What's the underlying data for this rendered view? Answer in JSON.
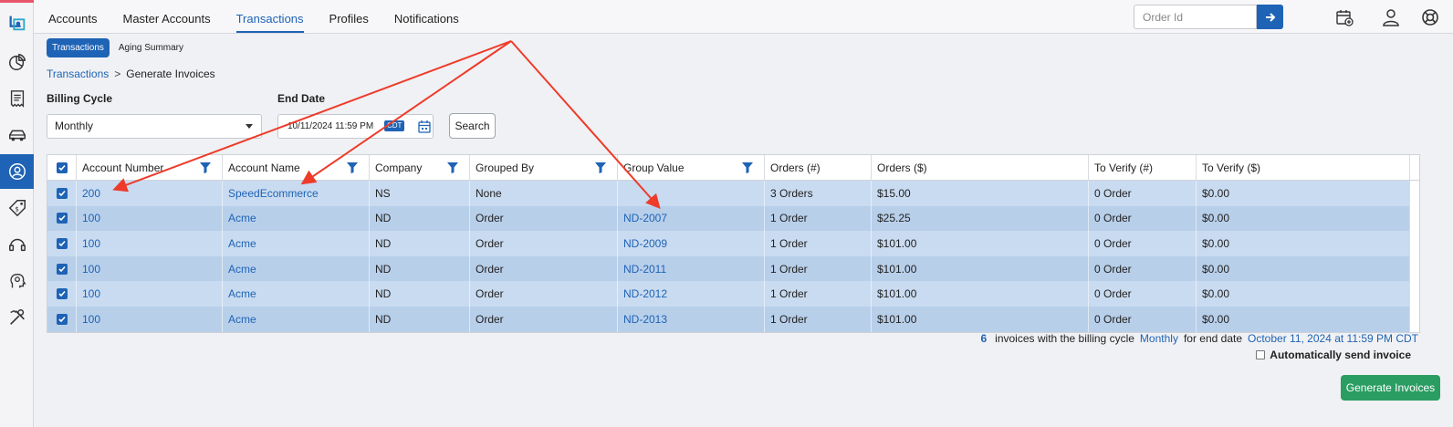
{
  "nav": {
    "tabs": [
      "Accounts",
      "Master Accounts",
      "Transactions",
      "Profiles",
      "Notifications"
    ],
    "active_tab": "Transactions",
    "order_placeholder": "Order Id"
  },
  "subtabs": [
    "Transactions",
    "Aging Summary"
  ],
  "breadcrumb": {
    "parent": "Transactions",
    "separator": ">",
    "current": "Generate Invoices"
  },
  "filters": {
    "billing_cycle_label": "Billing Cycle",
    "billing_cycle_value": "Monthly",
    "end_date_label": "End Date",
    "end_date_value": "10/11/2024 11:59 PM",
    "timezone": "CDT",
    "search_label": "Search"
  },
  "table": {
    "headers": [
      "Account Number",
      "Account Name",
      "Company",
      "Grouped By",
      "Group Value",
      "Orders (#)",
      "Orders ($)",
      "To Verify (#)",
      "To Verify ($)"
    ],
    "rows": [
      [
        "200",
        "SpeedEcommerce",
        "NS",
        "None",
        "",
        "3 Orders",
        "$15.00",
        "0 Order",
        "$0.00"
      ],
      [
        "100",
        "Acme",
        "ND",
        "Order",
        "ND-2007",
        "1 Order",
        "$25.25",
        "0 Order",
        "$0.00"
      ],
      [
        "100",
        "Acme",
        "ND",
        "Order",
        "ND-2009",
        "1 Order",
        "$101.00",
        "0 Order",
        "$0.00"
      ],
      [
        "100",
        "Acme",
        "ND",
        "Order",
        "ND-2011",
        "1 Order",
        "$101.00",
        "0 Order",
        "$0.00"
      ],
      [
        "100",
        "Acme",
        "ND",
        "Order",
        "ND-2012",
        "1 Order",
        "$101.00",
        "0 Order",
        "$0.00"
      ],
      [
        "100",
        "Acme",
        "ND",
        "Order",
        "ND-2013",
        "1 Order",
        "$101.00",
        "0 Order",
        "$0.00"
      ]
    ]
  },
  "summary": {
    "count": "6",
    "text1": "invoices with the billing cycle",
    "cycle": "Monthly",
    "text2": "for end date",
    "date": "October 11, 2024 at 11:59 PM CDT"
  },
  "auto_send_label": "Automatically send invoice",
  "generate_label": "Generate Invoices",
  "colors": {
    "accent": "#1e63b5",
    "generate": "#2a9d62",
    "arrow": "#ee3b2a",
    "row_odd": "#c9dbf0",
    "row_even": "#b8cfea"
  }
}
